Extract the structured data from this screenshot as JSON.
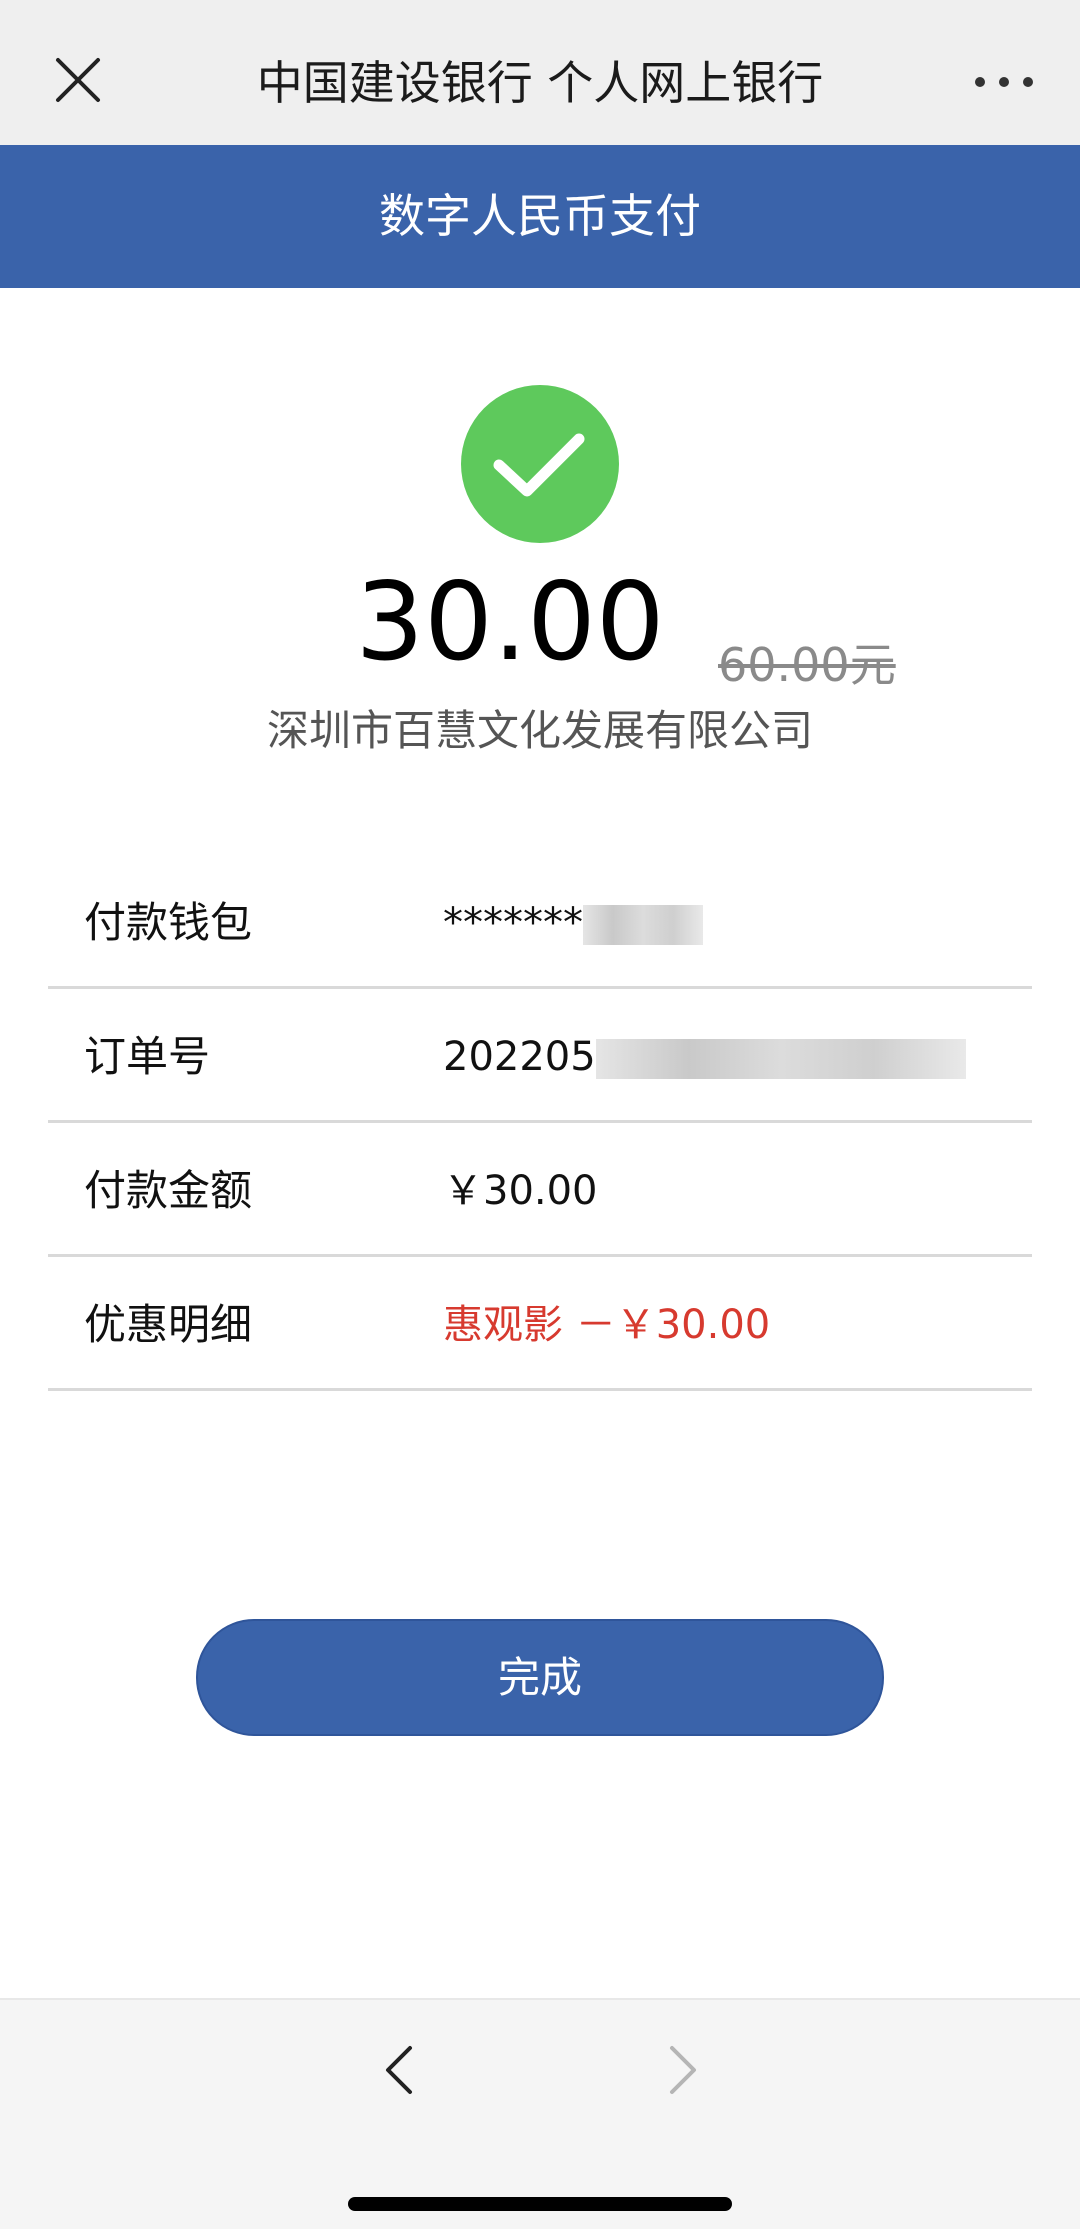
{
  "header": {
    "title": "中国建设银行 个人网上银行"
  },
  "subheader": {
    "title": "数字人民币支付"
  },
  "payment": {
    "amount": "30.00",
    "original_amount": "60.00元",
    "merchant": "深圳市百慧文化发展有限公司"
  },
  "details": {
    "wallet": {
      "label": "付款钱包",
      "value": "*******"
    },
    "order": {
      "label": "订单号",
      "value": "202205"
    },
    "paid": {
      "label": "付款金额",
      "value": "￥30.00"
    },
    "discount": {
      "label": "优惠明细",
      "value": "惠观影 －￥30.00"
    }
  },
  "actions": {
    "done_label": "完成"
  },
  "colors": {
    "brand_blue": "#3a63aa",
    "success_green": "#5ec95c",
    "discount_red": "#d73a2f"
  },
  "icons": {
    "close": "close-icon",
    "more": "more-icon",
    "success": "checkmark-icon",
    "back": "chevron-left-icon",
    "forward": "chevron-right-icon"
  }
}
